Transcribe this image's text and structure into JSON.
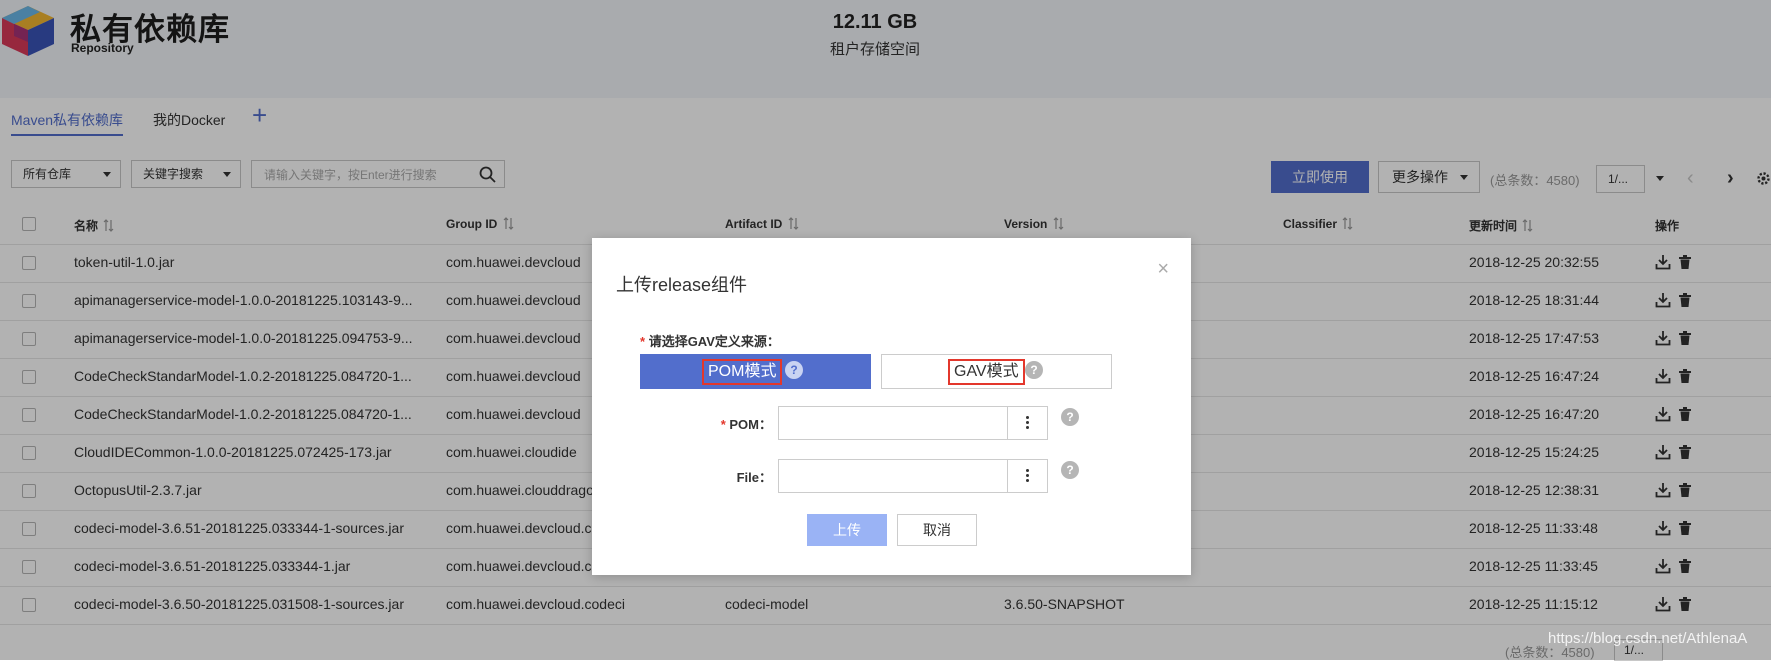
{
  "header": {
    "title": "私有依赖库",
    "subtitle": "Repository",
    "storage_size": "12.11 GB",
    "storage_label": "租户存储空间"
  },
  "tabs": [
    {
      "label": "Maven私有依赖库",
      "active": true
    },
    {
      "label": "我的Docker",
      "active": false
    }
  ],
  "tab_add": "+",
  "filters": {
    "repo_select": "所有仓库",
    "search_type": "关键字搜索",
    "search_placeholder": "请输入关键字，按Enter进行搜索"
  },
  "toolbar": {
    "use_now": "立即使用",
    "more_actions": "更多操作",
    "total": "(总条数：4580)",
    "page": "1/..."
  },
  "table": {
    "columns": [
      "名称",
      "Group ID",
      "Artifact ID",
      "Version",
      "Classifier",
      "更新时间",
      "操作"
    ],
    "rows": [
      {
        "name": "token-util-1.0.jar",
        "group": "com.huawei.devcloud",
        "artifact": "",
        "version": "",
        "classifier": "",
        "updated": "2018-12-25 20:32:55"
      },
      {
        "name": "apimanagerservice-model-1.0.0-20181225.103143-9...",
        "group": "com.huawei.devcloud",
        "artifact": "",
        "version": "",
        "classifier": "",
        "updated": "2018-12-25 18:31:44"
      },
      {
        "name": "apimanagerservice-model-1.0.0-20181225.094753-9...",
        "group": "com.huawei.devcloud",
        "artifact": "",
        "version": "",
        "classifier": "",
        "updated": "2018-12-25 17:47:53"
      },
      {
        "name": "CodeCheckStandarModel-1.0.2-20181225.084720-1...",
        "group": "com.huawei.devcloud",
        "artifact": "",
        "version": "",
        "classifier": "",
        "updated": "2018-12-25 16:47:24"
      },
      {
        "name": "CodeCheckStandarModel-1.0.2-20181225.084720-1...",
        "group": "com.huawei.devcloud",
        "artifact": "",
        "version": "",
        "classifier": "",
        "updated": "2018-12-25 16:47:20"
      },
      {
        "name": "CloudIDECommon-1.0.0-20181225.072425-173.jar",
        "group": "com.huawei.cloudide",
        "artifact": "",
        "version": "",
        "classifier": "",
        "updated": "2018-12-25 15:24:25"
      },
      {
        "name": "OctopusUtil-2.3.7.jar",
        "group": "com.huawei.clouddrago",
        "artifact": "",
        "version": "",
        "classifier": "",
        "updated": "2018-12-25 12:38:31"
      },
      {
        "name": "codeci-model-3.6.51-20181225.033344-1-sources.jar",
        "group": "com.huawei.devcloud.c",
        "artifact": "",
        "version": "",
        "classifier": "",
        "updated": "2018-12-25 11:33:48"
      },
      {
        "name": "codeci-model-3.6.51-20181225.033344-1.jar",
        "group": "com.huawei.devcloud.c",
        "artifact": "",
        "version": "",
        "classifier": "",
        "updated": "2018-12-25 11:33:45"
      },
      {
        "name": "codeci-model-3.6.50-20181225.031508-1-sources.jar",
        "group": "com.huawei.devcloud.codeci",
        "artifact": "codeci-model",
        "version": "3.6.50-SNAPSHOT",
        "classifier": "",
        "updated": "2018-12-25 11:15:12"
      }
    ]
  },
  "bottom": {
    "total": "(总条数：4580)",
    "page": "1/..."
  },
  "watermark": "https://blog.csdn.net/AthlenaA",
  "modal": {
    "title": "上传release组件",
    "close": "×",
    "required_mark": "*",
    "gav_source_label": "请选择GAV定义来源：",
    "pom_mode": "POM模式",
    "gav_mode": "GAV模式",
    "help_glyph": "?",
    "pom_label": "POM：",
    "file_label": "File：",
    "upload": "上传",
    "cancel": "取消"
  },
  "colors": {
    "primary": "#526ecc",
    "upload_disabled": "#9ab3f5",
    "highlight_border": "#e3372c"
  }
}
